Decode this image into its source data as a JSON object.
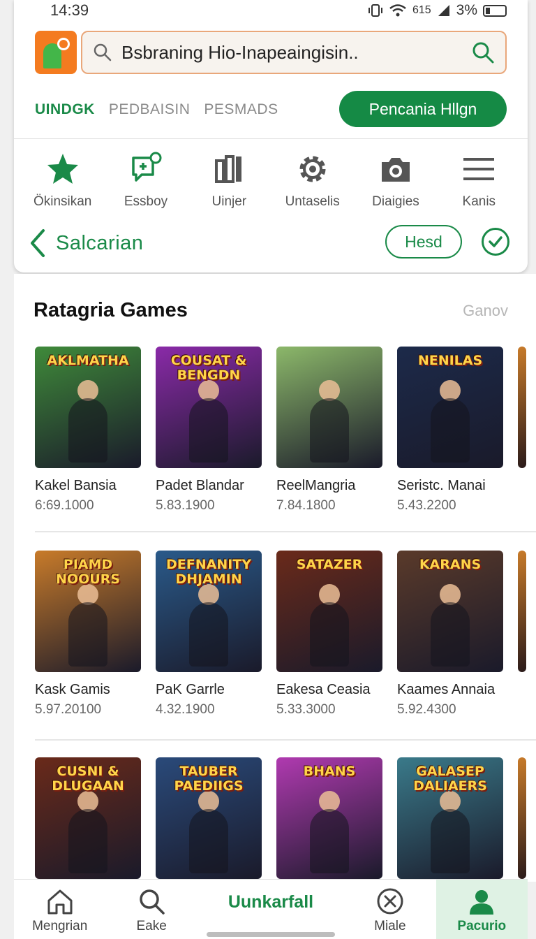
{
  "status_bar": {
    "time": "14:39",
    "signal_text": "615",
    "battery": "3%"
  },
  "search": {
    "value": "Bsbraning Hio-Inapeaingisin.."
  },
  "tabs": [
    {
      "label": "UINDGK",
      "active": true
    },
    {
      "label": "PEDBAISIN",
      "active": false
    },
    {
      "label": "PESMADS",
      "active": false
    }
  ],
  "cta_label": "Pencania Hllgn",
  "categories": [
    {
      "label": "Ökinsikan",
      "icon": "star-icon"
    },
    {
      "label": "Essboy",
      "icon": "chat-plus-icon"
    },
    {
      "label": "Uinjer",
      "icon": "columns-icon"
    },
    {
      "label": "Untaselis",
      "icon": "gear-icon"
    },
    {
      "label": "Diaigies",
      "icon": "camera-icon"
    },
    {
      "label": "Kanis",
      "icon": "menu-icon"
    }
  ],
  "back_title": "Salcarian",
  "pill_label": "Hesd",
  "section": {
    "title": "Ratagria Games",
    "more": "Ganov"
  },
  "rows": [
    [
      {
        "name": "Kakel Bansia",
        "stat": "6:69.1000",
        "logo": "AKLMATHA",
        "bg": "#3f8a3a"
      },
      {
        "name": "Padet Blandar",
        "stat": "5.83.1900",
        "logo": "COUSAT & BENGDN",
        "bg": "#8a2aa8"
      },
      {
        "name": "ReelMangria",
        "stat": "7.84.1800",
        "logo": "",
        "bg": "#8cb86a"
      },
      {
        "name": "Seristc. Manai",
        "stat": "5.43.2200",
        "logo": "NENILAS",
        "bg": "#1c2a4a"
      }
    ],
    [
      {
        "name": "Kask Gamis",
        "stat": "5.97.20100",
        "logo": "PIAMD NOOURS",
        "bg": "#c87b2a"
      },
      {
        "name": "PaK Garrle",
        "stat": "4.32.1900",
        "logo": "DEFNANITY DHJAMIN",
        "bg": "#2a5a8a"
      },
      {
        "name": "Eakesa Ceasia",
        "stat": "5.33.3000",
        "logo": "SATAZER",
        "bg": "#6a2a1a"
      },
      {
        "name": "Kaames Annaia",
        "stat": "5.92.4300",
        "logo": "KARANS",
        "bg": "#5a3a2a"
      }
    ],
    [
      {
        "name": "",
        "stat": "",
        "logo": "CUSNI & DLUGAAN",
        "bg": "#6a2a1a"
      },
      {
        "name": "",
        "stat": "",
        "logo": "TAUBER PAEDIIGS",
        "bg": "#2a4a7a"
      },
      {
        "name": "",
        "stat": "",
        "logo": "BHANS",
        "bg": "#b03ab0"
      },
      {
        "name": "",
        "stat": "",
        "logo": "GALASEP DALIAERS",
        "bg": "#3a7a8a"
      }
    ]
  ],
  "bottom_nav": {
    "home": "Mengrian",
    "search": "Eake",
    "center": "Uunkarfall",
    "close": "Miale",
    "profile": "Pacurio"
  },
  "colors": {
    "accent": "#1a8a48",
    "cta": "#158a45",
    "app_icon": "#f47b20"
  }
}
